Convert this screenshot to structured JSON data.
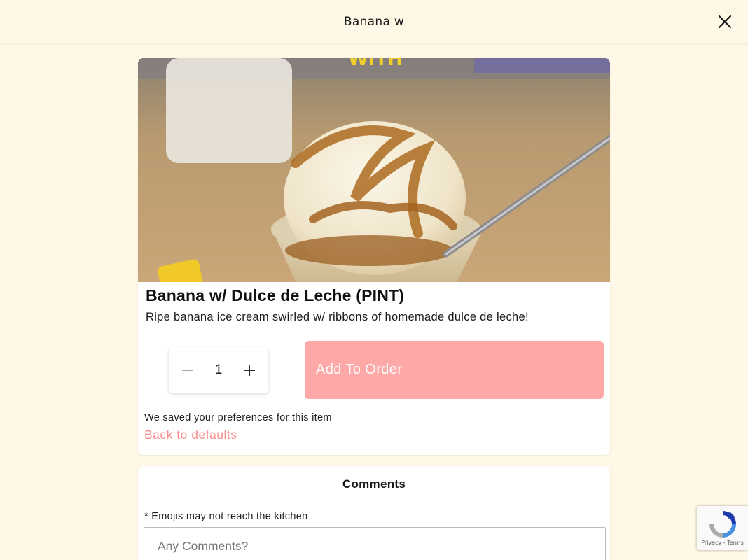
{
  "header": {
    "title": "Banana w"
  },
  "item": {
    "image_alt": "banana-dulce-de-leche-ice-cream-photo",
    "title": "Banana w/ Dulce de Leche (PINT)",
    "description": "Ripe banana ice cream swirled w/ ribbons of homemade dulce de leche!",
    "quantity": "1",
    "add_button_label": "Add To Order",
    "saved_message": "We saved your preferences for this item",
    "back_to_defaults_label": "Back to defaults"
  },
  "comments": {
    "title": "Comments",
    "note": "* Emojis may not reach the kitchen",
    "placeholder": "Any Comments?"
  },
  "recaptcha": {
    "links": "Privacy - Terms"
  },
  "colors": {
    "background": "#fff8e7",
    "accent": "#fea8a8",
    "link": "#f88f8f"
  },
  "icons": {
    "close": "close-icon",
    "minus": "minus-icon",
    "plus": "plus-icon",
    "recaptcha": "recaptcha-icon"
  }
}
